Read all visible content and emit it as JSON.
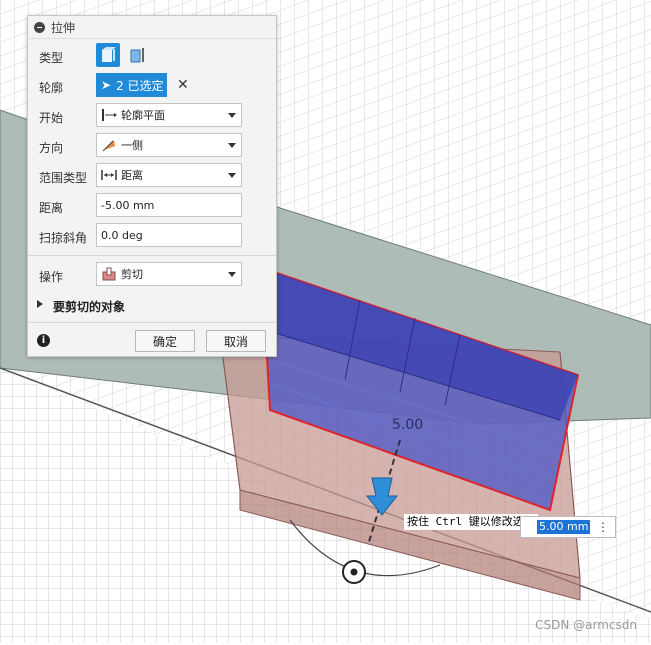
{
  "panel": {
    "title": "拉伸",
    "rows": {
      "type": {
        "label": "类型"
      },
      "profile": {
        "label": "轮廓",
        "selected": "2 已选定"
      },
      "start": {
        "label": "开始",
        "value": "轮廓平面"
      },
      "direction": {
        "label": "方向",
        "value": "一侧"
      },
      "extent": {
        "label": "范围类型",
        "value": "距离"
      },
      "distance": {
        "label": "距离",
        "value": "-5.00 mm"
      },
      "taper": {
        "label": "扫掠斜角",
        "value": "0.0 deg"
      },
      "operation": {
        "label": "操作",
        "value": "剪切"
      }
    },
    "section_label": "要剪切的对象",
    "ok_label": "确定",
    "cancel_label": "取消"
  },
  "viewport": {
    "dimension_label": "5.00",
    "tooltip": "按住 Ctrl 键以修改选择",
    "distance_input": "5.00 mm",
    "watermark": "CSDN @armcsdn"
  },
  "colors": {
    "accent": "#1f8ad8",
    "selection_blue": "#4a55c8",
    "cut_body": "#c79a94",
    "highlight_red": "#e0232a",
    "surface_gray": "#aebcb8"
  }
}
